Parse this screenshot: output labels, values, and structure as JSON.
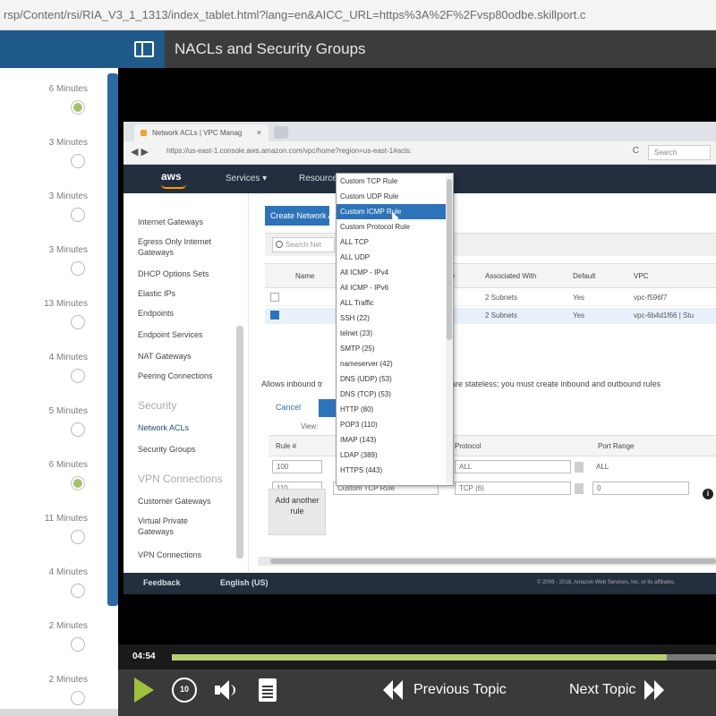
{
  "browser": {
    "url": "rsp/Content/rsi/RIA_V3_1_1313/index_tablet.html?lang=en&AICC_URL=https%3A%2F%2Fvsp80odbe.skillport.c"
  },
  "course": {
    "title": "NACLs and Security Groups"
  },
  "toc": {
    "items": [
      {
        "duration": "6 Minutes",
        "status": "done"
      },
      {
        "duration": "3 Minutes",
        "status": "todo"
      },
      {
        "duration": "3 Minutes",
        "status": "todo"
      },
      {
        "duration": "3 Minutes",
        "status": "todo"
      },
      {
        "duration": "13 Minutes",
        "status": "todo"
      },
      {
        "duration": "4 Minutes",
        "status": "todo"
      },
      {
        "duration": "5 Minutes",
        "status": "todo"
      },
      {
        "duration": "6 Minutes",
        "status": "done"
      },
      {
        "duration": "11 Minutes",
        "status": "todo"
      },
      {
        "duration": "4 Minutes",
        "status": "todo"
      },
      {
        "duration": "2 Minutes",
        "status": "todo"
      },
      {
        "duration": "2 Minutes",
        "status": "todo"
      }
    ]
  },
  "inner": {
    "tab_title": "Network ACLs | VPC Manag",
    "tab_close": "×",
    "url": "https://us-east-1.console.aws.amazon.com/vpc/home?region=us-east-1#acls:",
    "search_placeholder": "Search",
    "nav_back": "◀  ▶",
    "reload": "C",
    "aws_logo": "aws",
    "services": "Services ▾",
    "resource_groups": "Resource",
    "vpc_nav": {
      "internet_gateways": "Internet Gateways",
      "egress_only": "Egress Only Internet Gateways",
      "dhcp": "DHCP Options Sets",
      "elastic_ips": "Elastic IPs",
      "endpoints": "Endpoints",
      "endpoint_services": "Endpoint Services",
      "nat": "NAT Gateways",
      "peering": "Peering Connections",
      "security_header": "Security",
      "network_acls": "Network ACLs",
      "security_groups": "Security Groups",
      "vpn_header": "VPN Connections",
      "customer_gateways": "Customer Gateways",
      "virtual_private": "Virtual Private Gateways",
      "vpn_connections": "VPN Connections"
    },
    "create_button": "Create Network ACL",
    "filter_placeholder": "Search Net",
    "grid_headers": {
      "name": "Name",
      "id": "ID",
      "associated": "Associated With",
      "default": "Default",
      "vpc": "VPC"
    },
    "grid_rows": [
      {
        "associated": "2 Subnets",
        "default": "Yes",
        "vpc": "vpc-f596f7"
      },
      {
        "associated": "2 Subnets",
        "default": "Yes",
        "vpc": "vpc-6b4d1f66 | Stu"
      }
    ],
    "description_left": "Allows inbound tr",
    "description_right": "are stateless; you must create inbound and outbound rules",
    "cancel": "Cancel",
    "view_label": "View:",
    "rules_headers": {
      "rule_no": "Rule #",
      "protocol": "Protocol",
      "port_range": "Port Range"
    },
    "rules": [
      {
        "rule_no": "100",
        "protocol": "ALL",
        "port_range": "ALL"
      },
      {
        "rule_no": "110",
        "type": "Custom TCP Rule",
        "protocol": "TCP (6)",
        "port_range": "0"
      }
    ],
    "add_rule": "Add another rule",
    "footer_feedback": "Feedback",
    "footer_language": "English (US)",
    "footer_copyright": "© 2008 - 2018, Amazon Web Services, Inc. or its affiliates."
  },
  "dropdown": {
    "items": [
      "Custom TCP Rule",
      "Custom UDP Rule",
      "Custom ICMP Rule",
      "Custom Protocol Rule",
      "ALL TCP",
      "ALL UDP",
      "All ICMP - IPv4",
      "All ICMP - IPv6",
      "ALL Traffic",
      "SSH (22)",
      "telnet (23)",
      "SMTP (25)",
      "nameserver (42)",
      "DNS (UDP) (53)",
      "DNS (TCP) (53)",
      "HTTP (80)",
      "POP3 (110)",
      "IMAP (143)",
      "LDAP (389)",
      "HTTPS (443)"
    ],
    "highlighted_index": 2
  },
  "player": {
    "time": "04:54",
    "progress": 0.91,
    "replay_label": "10",
    "previous": "Previous Topic",
    "next": "Next Topic"
  },
  "colors": {
    "accent_blue": "#2e73b8",
    "progress_green": "#b5cf6e",
    "play_green": "#9ec23e"
  }
}
